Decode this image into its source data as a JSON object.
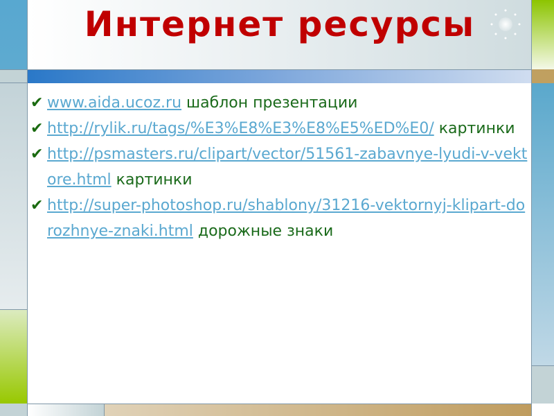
{
  "slide": {
    "title": "Интернет ресурсы",
    "items": [
      {
        "link": "www.aida.ucoz.ru",
        "desc": "шаблон презентации"
      },
      {
        "link": "http://rylik.ru/tags/%E3%E8%E3%E8%E5%ED%E0/",
        "desc": "картинки"
      },
      {
        "link": "http://psmasters.ru/clipart/vector/51561-zabavnye-lyudi-v-vektore.html",
        "desc": "картинки"
      },
      {
        "link": "http://super-photoshop.ru/shablony/31216-vektornyj-klipart-dorozhnye-znaki.html",
        "desc": "дорожные знаки"
      }
    ],
    "check_glyph": "✔",
    "colors": {
      "title": "#c00000",
      "link": "#5aa8d0",
      "text": "#1a6a1a"
    }
  }
}
